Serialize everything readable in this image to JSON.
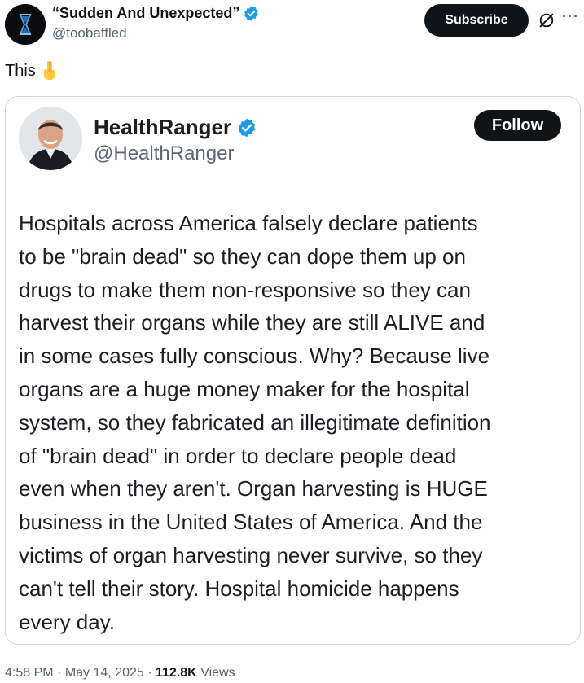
{
  "author": {
    "display_name": "“Sudden And Unexpected”",
    "handle": "@toobaffled",
    "avatar_icon": "hourglass-avatar",
    "verified_icon": "verified-badge-icon"
  },
  "actions": {
    "subscribe_label": "Subscribe",
    "grok_icon": "grok-icon",
    "more_icon": "more-options-icon",
    "more_label": "···"
  },
  "tweet": {
    "text": "This",
    "emoji": "backhand-index-pointing-down"
  },
  "embedded": {
    "name": "HealthRanger",
    "handle": "@HealthRanger",
    "follow_label": "Follow",
    "lines": [
      "Hospitals across America falsely declare patients",
      "to be \"brain dead\" so they can dope them up on",
      "drugs to make them non-responsive so they can",
      "harvest their organs while they are still ALIVE and",
      "in some cases fully conscious. Why? Because live",
      "organs are a huge money maker for the hospital",
      "system, so they fabricated an illegitimate definition",
      "of \"brain dead\" in order to declare people dead",
      "even when they aren't. Organ harvesting is HUGE",
      "business in the United States of America. And the",
      "victims of organ harvesting never survive, so they",
      "can't tell their story. Hospital homicide happens",
      "every day."
    ]
  },
  "meta": {
    "time": "4:58 PM",
    "date": "May 14, 2025",
    "views_count": "112.8K",
    "views_label": "Views",
    "separator": "·"
  },
  "colors": {
    "verified": "#1d9bf0",
    "text_primary": "#0f1419",
    "text_secondary": "#536471",
    "button_dark": "#0f1419",
    "card_border": "#cfd9de"
  }
}
